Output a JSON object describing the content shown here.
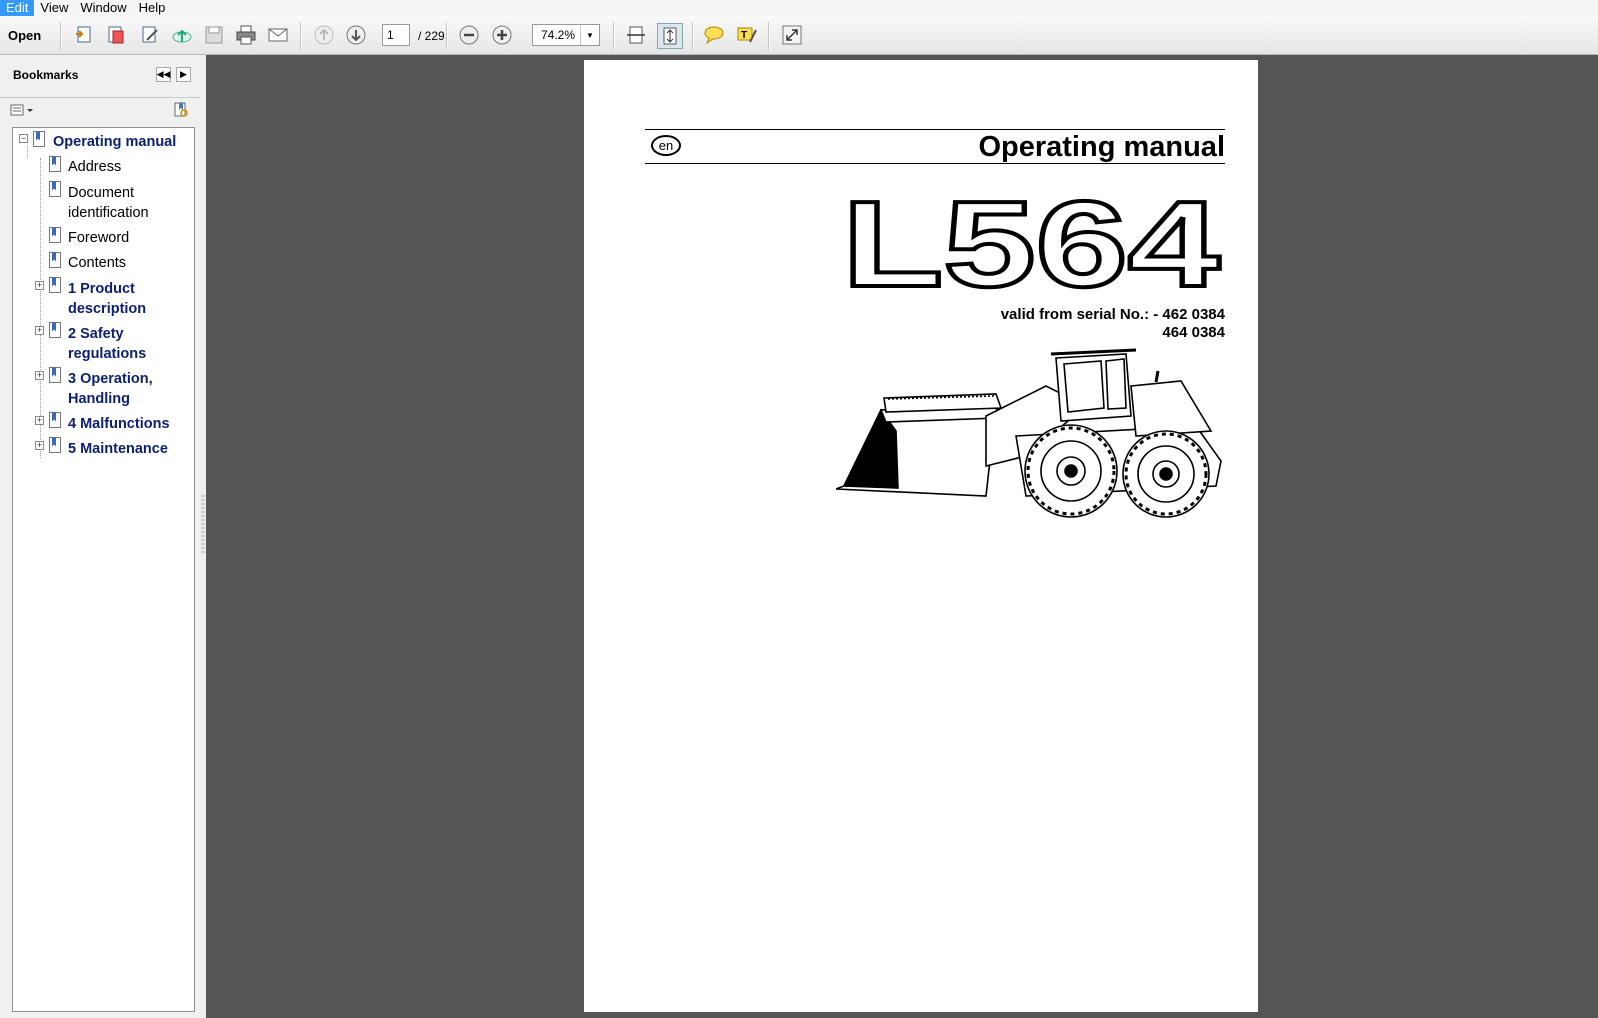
{
  "menu": [
    "Edit",
    "View",
    "Window",
    "Help"
  ],
  "toolbar": {
    "open_label": "Open",
    "page_current": "1",
    "page_total": "/  229",
    "zoom": "74.2%"
  },
  "bookmarks": {
    "title": "Bookmarks",
    "items": [
      {
        "label": "Operating manual",
        "bold": true
      },
      {
        "label": "Address"
      },
      {
        "label": "Document identification"
      },
      {
        "label": "Foreword"
      },
      {
        "label": "Contents"
      },
      {
        "label": "1 Product description",
        "bold": true
      },
      {
        "label": "2 Safety regulations",
        "bold": true
      },
      {
        "label": "3 Operation, Handling",
        "bold": true
      },
      {
        "label": "4 Malfunctions",
        "bold": true
      },
      {
        "label": "5 Maintenance",
        "bold": true
      }
    ]
  },
  "document": {
    "language": "en",
    "title": "Operating manual",
    "model": "L564",
    "serial_line1": "valid from serial No.: - 462 0384",
    "serial_line2": "464 0384"
  }
}
